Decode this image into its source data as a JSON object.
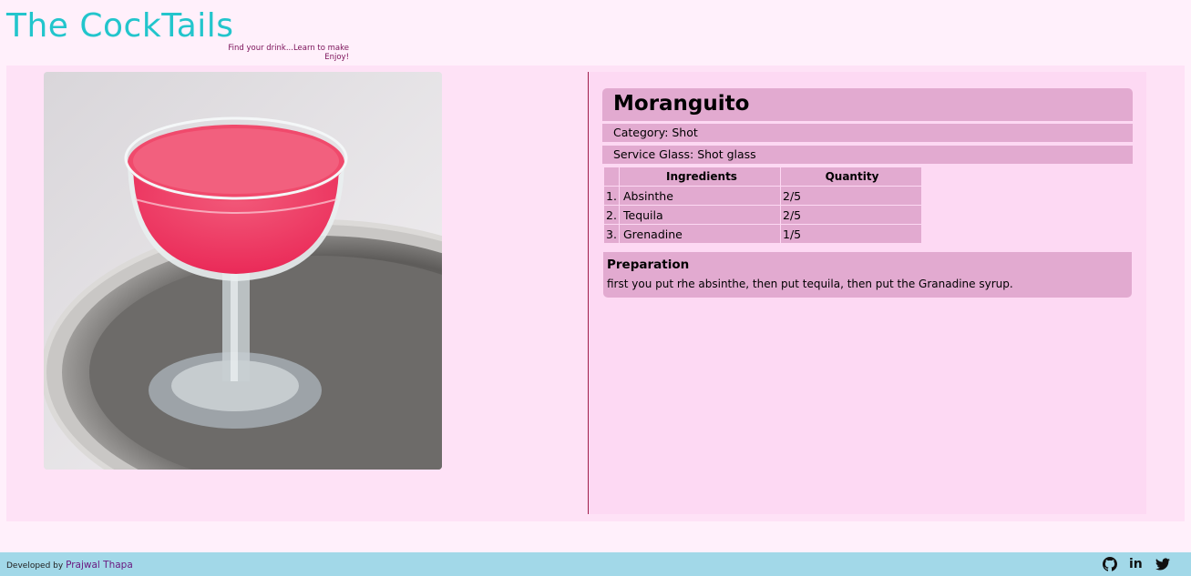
{
  "header": {
    "brand": "The CockTails",
    "tagline_line1": "Find your drink...Learn to make",
    "tagline_line2": "Enjoy!"
  },
  "drink": {
    "name": "Moranguito",
    "category": "Category: Shot",
    "glass": "Service Glass: Shot glass",
    "ingredients_header": "Ingredients",
    "quantity_header": "Quantity",
    "ingredients": [
      {
        "num": "1.",
        "name": "Absinthe",
        "qty": "2/5"
      },
      {
        "num": "2.",
        "name": "Tequila",
        "qty": "2/5"
      },
      {
        "num": "3.",
        "name": "Grenadine",
        "qty": "1/5"
      }
    ],
    "preparation_title": "Preparation",
    "preparation_text": "first you put rhe absinthe, then put tequila, then put the Granadine syrup."
  },
  "footer": {
    "developed_by": "Developed by",
    "developer": "Prajwal Thapa",
    "icons": [
      "github-icon",
      "linkedin-icon",
      "twitter-icon"
    ]
  },
  "colors": {
    "brand": "#22c5cc",
    "page_bg": "#fff0fb",
    "panel_bg": "#fee2f6",
    "card_bg": "#e2aad0",
    "footer_bg": "#a2d8e8",
    "divider": "#a0204a"
  }
}
